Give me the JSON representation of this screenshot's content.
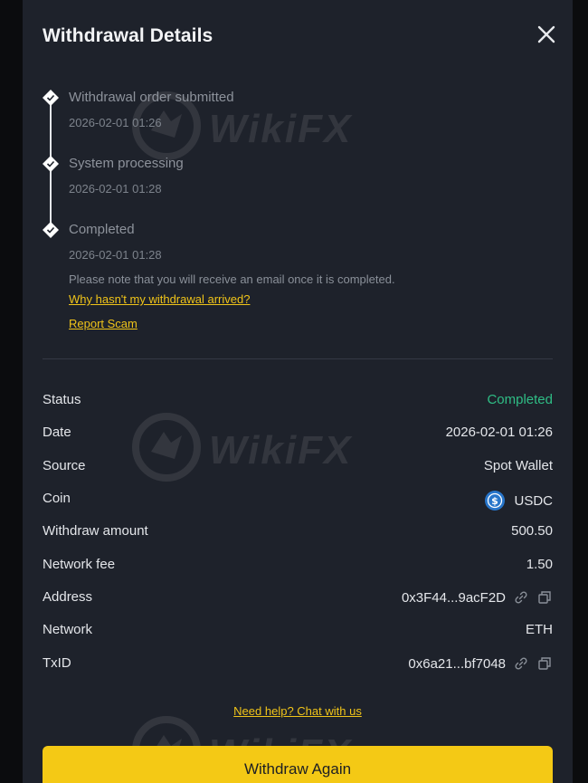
{
  "header": {
    "title": "Withdrawal Details"
  },
  "timeline": [
    {
      "title": "Withdrawal order submitted",
      "time": "2026-02-01 01:26"
    },
    {
      "title": "System processing",
      "time": "2026-02-01 01:28"
    },
    {
      "title": "Completed",
      "time": "2026-02-01 01:28"
    }
  ],
  "note": "Please note that you will receive an email once it is completed.",
  "links": {
    "why_not_arrived": "Why hasn't my withdrawal arrived?",
    "report_scam": "Report Scam",
    "help": "Need help? Chat with us"
  },
  "details": {
    "status": {
      "label": "Status",
      "value": "Completed"
    },
    "date": {
      "label": "Date",
      "value": "2026-02-01 01:26"
    },
    "source": {
      "label": "Source",
      "value": "Spot Wallet"
    },
    "coin": {
      "label": "Coin",
      "value": "USDC",
      "icon": "usdc-coin-icon"
    },
    "amount": {
      "label": "Withdraw amount",
      "value": "500.50"
    },
    "fee": {
      "label": "Network fee",
      "value": "1.50"
    },
    "address": {
      "label": "Address",
      "value": "0x3F44...9acF2D"
    },
    "network": {
      "label": "Network",
      "value": "ETH"
    },
    "txid": {
      "label": "TxID",
      "value": "0x6a21...bf7048"
    }
  },
  "button": {
    "label": "Withdraw Again"
  },
  "watermark": {
    "text": "WikiFX"
  },
  "colors": {
    "accent": "#f4c915",
    "success": "#2fbd85",
    "background": "#1e222b"
  }
}
